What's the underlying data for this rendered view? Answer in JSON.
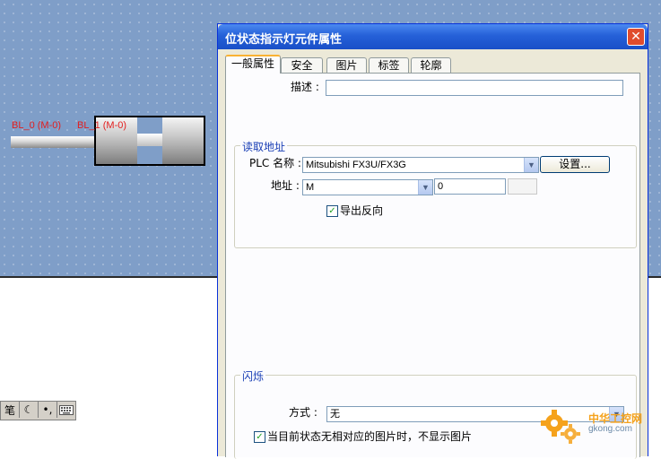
{
  "canvas": {
    "lamp0_label": "BL_0 (M-0)",
    "lamp1_label": "BL_1 (M-0)"
  },
  "ime_toolbar": {
    "icons": [
      "笔",
      "moon-icon",
      "punct-icon",
      "keyboard-icon"
    ],
    "pen_glyph": "笔"
  },
  "dialog": {
    "title": "位状态指示灯元件属性",
    "close_glyph": "✕",
    "tabs": [
      "一般属性",
      "安全",
      "图片",
      "标签",
      "轮廓"
    ],
    "description": {
      "label": "描述 :",
      "value": ""
    },
    "read_address": {
      "title": "读取地址",
      "plc_label": "PLC 名称 :",
      "plc_value": "Mitsubishi FX3U/FX3G",
      "settings_button": "设置...",
      "address_label": "地址 :",
      "address_device": "M",
      "address_value": "0",
      "invert_label": "导出反向",
      "invert_checked": true
    },
    "blink": {
      "title": "闪烁",
      "mode_label": "方式 :",
      "mode_value": "无",
      "hide_label": "当目前状态无相对应的图片时，不显示图片",
      "hide_checked": true
    }
  },
  "watermark": {
    "text": "中华工控网",
    "url": "gkong.com"
  },
  "colors": {
    "accent": "#2560d8",
    "label_red": "#e31e1e",
    "group_title": "#1a3fb5"
  }
}
